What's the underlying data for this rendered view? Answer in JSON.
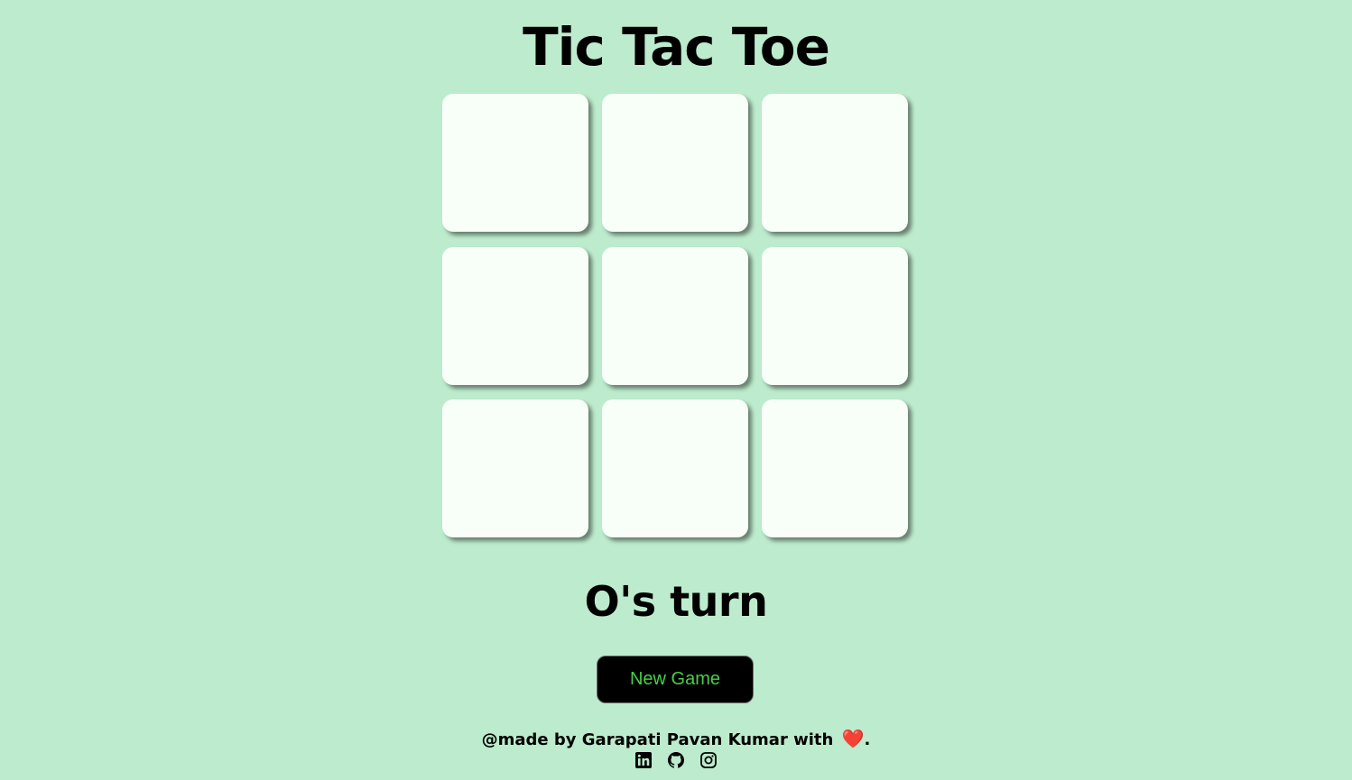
{
  "title": "Tic Tac Toe",
  "board": {
    "cells": [
      "",
      "",
      "",
      "",
      "",
      "",
      "",
      "",
      ""
    ]
  },
  "status": {
    "turn_text": "O's turn"
  },
  "controls": {
    "new_game_label": "New Game"
  },
  "footer": {
    "credit_text": "@made by Garapati Pavan Kumar with",
    "heart": "❤️",
    "trailing": ".",
    "socials": [
      {
        "name": "linkedin-icon"
      },
      {
        "name": "github-icon"
      },
      {
        "name": "instagram-icon"
      }
    ]
  },
  "colors": {
    "background": "#bdebcd",
    "cell": "#f8fff8",
    "button_bg": "#000000",
    "button_text": "#46d146"
  }
}
